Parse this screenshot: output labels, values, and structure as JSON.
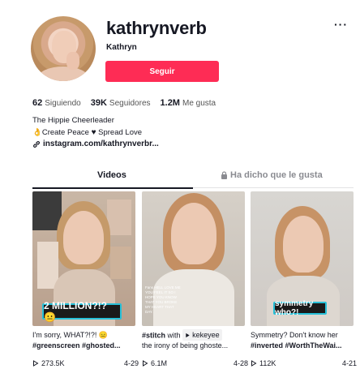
{
  "profile": {
    "username": "kathrynverb",
    "nickname": "Kathryn",
    "follow_label": "Seguir",
    "more_label": "···"
  },
  "stats": {
    "following_count": "62",
    "following_label": "Siguiendo",
    "followers_count": "39K",
    "followers_label": "Seguidores",
    "likes_count": "1.2M",
    "likes_label": "Me gusta"
  },
  "bio": {
    "line1": "The Hippie Cheerleader",
    "line2_a": "👌Create Peace ",
    "line2_heart": "♥",
    "line2_b": " Spread Love",
    "link": "instagram.com/kathrynverbr..."
  },
  "tabs": {
    "videos": "Videos",
    "liked": "Ha dicho que le gusta"
  },
  "videos": [
    {
      "caption": "I'm sorry, WHAT?!?! 😑",
      "tags": "#greenscreen #ghosted...",
      "views": "273.5K",
      "date": "4-29",
      "overlay": "2 MILLION?!? 😐"
    },
    {
      "caption_tag": "#stitch",
      "caption_with": "with",
      "caption_user": "kekeyee",
      "tags": "the irony of being ghoste...",
      "views": "6.1M",
      "date": "4-28",
      "small_text": "Fans HELL LOVE ME YOU FEEL IT SO I HOPE YOU KNOW THAT YOU BROKE MY HEART THAT DAY."
    },
    {
      "caption": "Symmetry? Don't know her",
      "tags": "#inverted #WorthTheWai...",
      "views": "112K",
      "date": "4-21",
      "overlay": "symmetry who?!"
    }
  ],
  "colors": {
    "accent": "#fe2c55",
    "text": "#161823",
    "muted": "#8a8b91",
    "overlay_border": "#27c0d8"
  }
}
